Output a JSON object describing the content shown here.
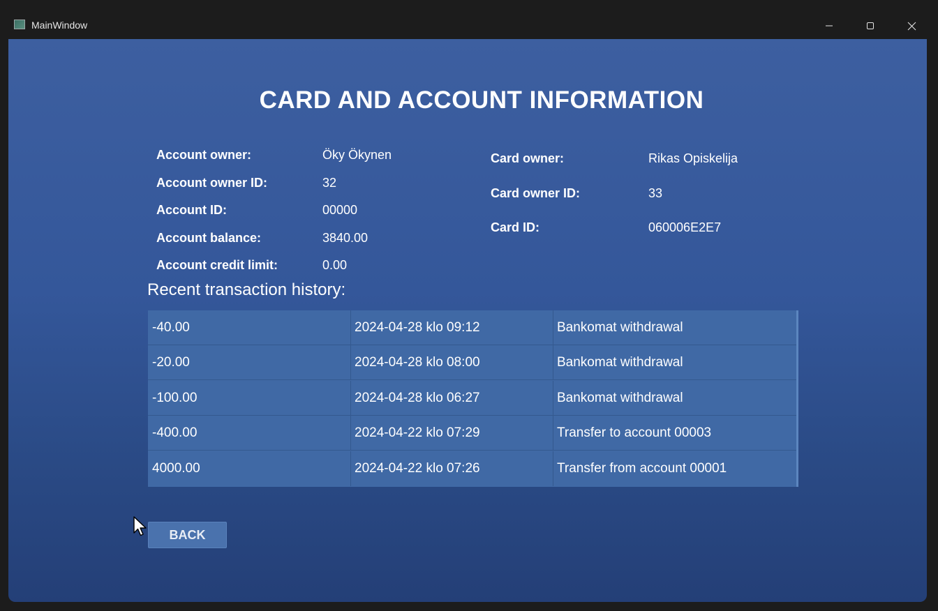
{
  "window": {
    "title": "MainWindow"
  },
  "heading": "CARD AND ACCOUNT INFORMATION",
  "account": {
    "owner_label": "Account owner:",
    "owner_value": "Öky Ökynen",
    "owner_id_label": "Account owner ID:",
    "owner_id_value": "32",
    "id_label": "Account ID:",
    "id_value": "00000",
    "balance_label": "Account balance:",
    "balance_value": "3840.00",
    "credit_label": "Account credit limit:",
    "credit_value": "0.00"
  },
  "card": {
    "owner_label": "Card owner:",
    "owner_value": "Rikas Opiskelija",
    "owner_id_label": "Card owner ID:",
    "owner_id_value": "33",
    "id_label": "Card ID:",
    "id_value": "060006E2E7"
  },
  "history": {
    "title": "Recent transaction history:",
    "rows": [
      {
        "amount": "-40.00",
        "date": "2024-04-28 klo 09:12",
        "description": "Bankomat withdrawal"
      },
      {
        "amount": "-20.00",
        "date": "2024-04-28 klo 08:00",
        "description": "Bankomat withdrawal"
      },
      {
        "amount": "-100.00",
        "date": "2024-04-28 klo 06:27",
        "description": "Bankomat withdrawal"
      },
      {
        "amount": "-400.00",
        "date": "2024-04-22 klo 07:29",
        "description": "Transfer to account 00003"
      },
      {
        "amount": "4000.00",
        "date": "2024-04-22 klo 07:26",
        "description": "Transfer from account 00001"
      }
    ]
  },
  "back_button": "BACK",
  "icons": {
    "app": "app-window-icon",
    "minimize": "minimize-icon",
    "maximize": "maximize-icon",
    "close": "close-icon",
    "cursor": "mouse-pointer-icon"
  },
  "colors": {
    "background_top": "#3d5fa0",
    "background_bottom": "#243f77",
    "table_background": "#4069a5",
    "button_background": "#4a72ad",
    "titlebar": "#1c1c1c"
  }
}
